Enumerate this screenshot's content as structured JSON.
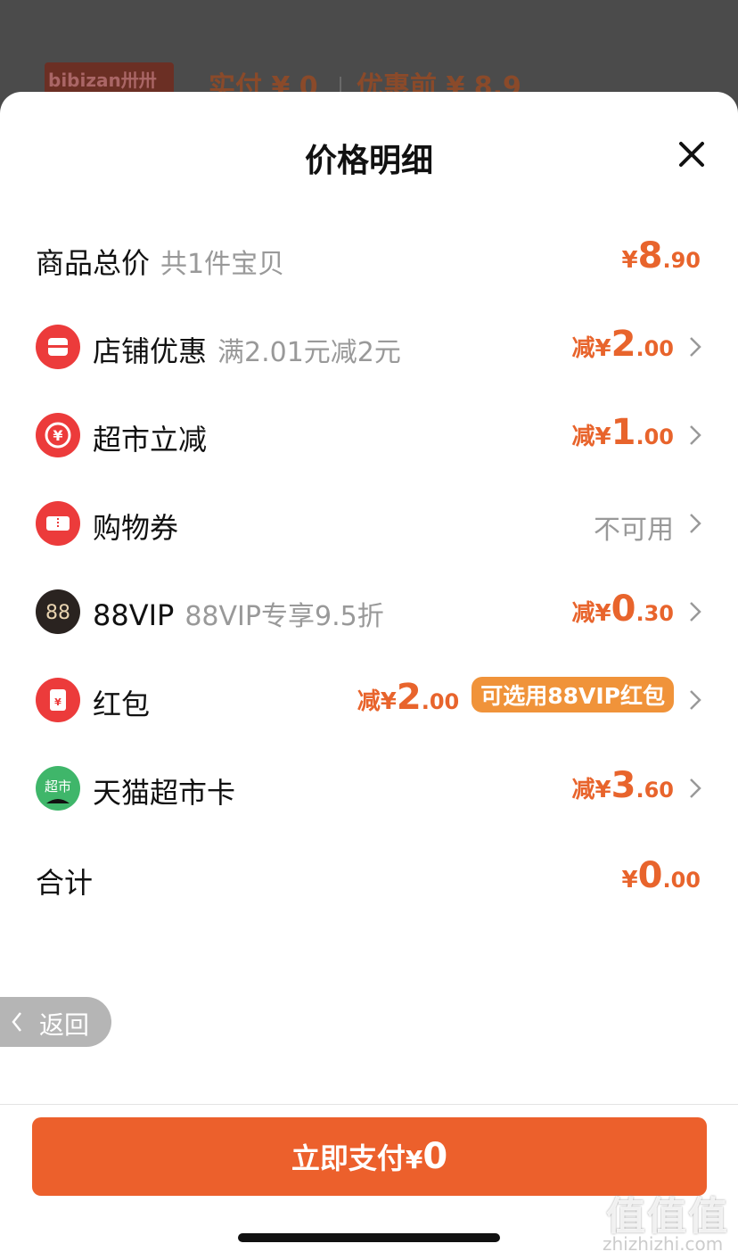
{
  "background": {
    "thumb_text": "bibizan卅卅翠",
    "paid": "实付 ¥ 0",
    "before": "优惠前 ¥ 8.9"
  },
  "sheet": {
    "title": "价格明细",
    "close_icon": "close-icon"
  },
  "rows": [
    {
      "label": "商品总价",
      "sub": "共1件宝贝",
      "prefix": "¥",
      "int": "8",
      "dec": ".90"
    },
    {
      "label": "店铺优惠",
      "sub": "满2.01元减2元",
      "prefix": "减¥",
      "int": "2",
      "dec": ".00",
      "icon": "shop-icon"
    },
    {
      "label": "超市立减",
      "prefix": "减¥",
      "int": "1",
      "dec": ".00",
      "icon": "yen-discount-icon"
    },
    {
      "label": "购物券",
      "status": "不可用",
      "icon": "coupon-icon"
    },
    {
      "label": "88VIP",
      "sub": "88VIP专享9.5折",
      "prefix": "减¥",
      "int": "0",
      "dec": ".30",
      "icon": "88vip-icon",
      "icon_text": "88"
    },
    {
      "label": "红包",
      "prefix": "减¥",
      "int": "2",
      "dec": ".00",
      "badge": "可选用88VIP红包",
      "icon": "red-packet-icon"
    },
    {
      "label": "天猫超市卡",
      "prefix": "减¥",
      "int": "3",
      "dec": ".60",
      "icon": "tmall-supermarket-card-icon",
      "icon_text": "超市"
    },
    {
      "label": "合计",
      "prefix": "¥",
      "int": "0",
      "dec": ".00"
    }
  ],
  "back": {
    "label": "返回"
  },
  "pay": {
    "label": "立即支付",
    "prefix": "¥",
    "amount": "0"
  },
  "watermark": {
    "text": "值值值",
    "url": "zhizhizhi.com"
  },
  "colors": {
    "accent": "#ec602c",
    "discount": "#e8642c",
    "badge": "#f0933a"
  }
}
